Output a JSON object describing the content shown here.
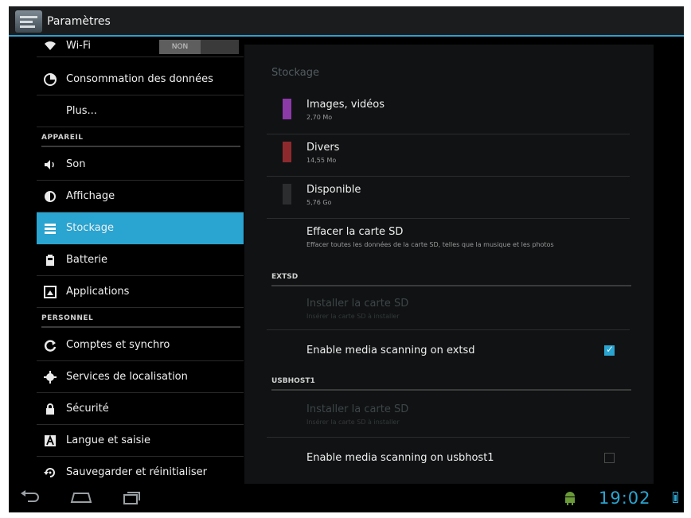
{
  "app": {
    "title": "Paramètres"
  },
  "sidebar": {
    "wifi": {
      "label": "Wi-Fi",
      "toggle": "NON"
    },
    "items": [
      {
        "label": "Consommation des données",
        "icon": "data-usage-icon"
      },
      {
        "label": "Plus..."
      }
    ],
    "section_device": "APPAREIL",
    "device_items": [
      {
        "label": "Son",
        "icon": "speaker-icon"
      },
      {
        "label": "Affichage",
        "icon": "brightness-icon"
      },
      {
        "label": "Stockage",
        "icon": "storage-icon",
        "selected": true
      },
      {
        "label": "Batterie",
        "icon": "battery-icon"
      },
      {
        "label": "Applications",
        "icon": "apps-icon"
      }
    ],
    "section_personal": "PERSONNEL",
    "personal_items": [
      {
        "label": "Comptes et synchro",
        "icon": "sync-icon"
      },
      {
        "label": "Services de localisation",
        "icon": "location-icon"
      },
      {
        "label": "Sécurité",
        "icon": "lock-icon"
      },
      {
        "label": "Langue et saisie",
        "icon": "language-icon"
      },
      {
        "label": "Sauvegarder et réinitialiser",
        "icon": "backup-icon"
      }
    ]
  },
  "storage": {
    "title": "Stockage",
    "entries": [
      {
        "title": "Images, vidéos",
        "size": "2,70 Mo",
        "color": "#8b3aa8"
      },
      {
        "title": "Divers",
        "size": "14,55 Mo",
        "color": "#8e2a2e"
      },
      {
        "title": "Disponible",
        "size": "5,76 Go",
        "color": "#2b2d2f"
      }
    ],
    "erase": {
      "title": "Effacer la carte SD",
      "desc": "Effacer toutes les données de la carte SD, telles que la musique et les photos"
    },
    "extsd": {
      "header": "EXTSD",
      "install_title": "Installer la carte SD",
      "install_desc": "Insérer la carte SD à installer",
      "scan_label": "Enable media scanning on extsd",
      "scan_checked": true
    },
    "usbhost1": {
      "header": "USBHOST1",
      "install_title": "Installer la carte SD",
      "install_desc": "Insérer la carte SD à installer",
      "scan_label": "Enable media scanning on usbhost1",
      "scan_checked": false
    }
  },
  "status": {
    "time": "19:02"
  },
  "colors": {
    "accent": "#2aa4d0",
    "background": "#000000",
    "panel": "#101213"
  }
}
